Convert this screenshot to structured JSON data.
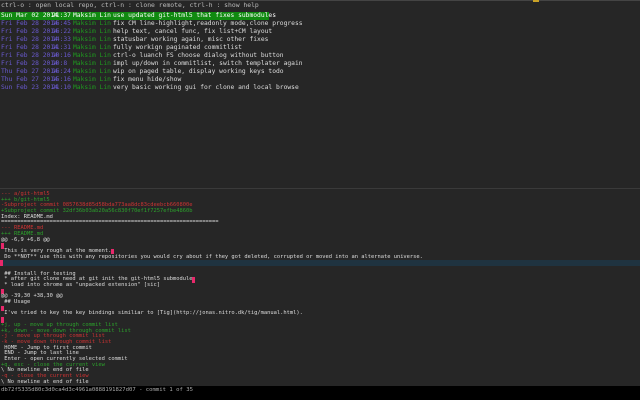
{
  "help_text": "ctrl-o : open local repo, ctrl-n : clone remote, ctrl-h : show help",
  "commits": [
    {
      "date": "Sun Mar 02 2014",
      "time": "21:37",
      "author": "Maksim Lin",
      "message": "use updated git-html5 that fixes submodules",
      "selected": true
    },
    {
      "date": "Fri Feb 28 2014",
      "time": "16:45",
      "author": "Maksim Lin",
      "message": "fix CM line-highlight,readonly mode,clone progress"
    },
    {
      "date": "Fri Feb 28 2014",
      "time": "16:22",
      "author": "Maksim Lin",
      "message": "help text, cancel func, fix list+CM layout"
    },
    {
      "date": "Fri Feb 28 2014",
      "time": "14:33",
      "author": "Maksim Lin",
      "message": "statusbar working again, misc other fixes"
    },
    {
      "date": "Fri Feb 28 2014",
      "time": "11:31",
      "author": "Maksim Lin",
      "message": "fully workign paginated commitlist"
    },
    {
      "date": "Fri Feb 28 2014",
      "time": "10:16",
      "author": "Maksim Lin",
      "message": "ctrl-o luanch FS choose dialog without button"
    },
    {
      "date": "Fri Feb 28 2014",
      "time": "10:8",
      "author": "Maksim Lin",
      "message": "impl up/down in commitlist, switch templater again"
    },
    {
      "date": "Thu Feb 27 2014",
      "time": "16:24",
      "author": "Maksim Lin",
      "message": "wip on paged table, display working keys todo"
    },
    {
      "date": "Thu Feb 27 2014",
      "time": "15:16",
      "author": "Maksim Lin",
      "message": "fix menu hide/show"
    },
    {
      "date": "Sun Feb 23 2014",
      "time": "21:10",
      "author": "Maksim Lin",
      "message": "very basic working gui for clone and local browse"
    }
  ],
  "diff_lines": [
    {
      "t": "--- a/git-html5",
      "k": "del"
    },
    {
      "t": "+++ b/git-html5",
      "k": "add"
    },
    {
      "t": "-Subproject commit 0857638d85d58bda773aa8dc83cdeebcb660800e",
      "k": "del"
    },
    {
      "t": "+Subproject commit 32df36b03ab20a56c830f70ef1f7257efbe4860b",
      "k": "add"
    },
    {
      "t": "Index: README.md",
      "k": ""
    },
    {
      "t": "===================================================================",
      "k": ""
    },
    {
      "t": "--- README.md",
      "k": "del"
    },
    {
      "t": "+++ README.md",
      "k": "add"
    },
    {
      "t": "@@ -6,9 +6,8 @@",
      "k": ""
    },
    {
      "t": "",
      "k": "",
      "m": true
    },
    {
      "t": " This is very rough at the moment.",
      "k": "",
      "me": true
    },
    {
      "t": " Do **NOT** use this with any repositories you would cry about if they got deleted, corrupted or moved into an alternate universe.",
      "k": ""
    },
    {
      "t": "",
      "k": "hl",
      "m": true
    },
    {
      "t": " ",
      "k": ""
    },
    {
      "t": " ## Install for testing",
      "k": ""
    },
    {
      "t": " * after git clone need at git init the git-html5 submodule",
      "k": "",
      "me": true
    },
    {
      "t": " * load into chrome as \"unpacked extension\" [sic]",
      "k": ""
    },
    {
      "t": "",
      "k": "",
      "m": true
    },
    {
      "t": "@@ -39,30 +38,30 @@",
      "k": ""
    },
    {
      "t": " ## Usage",
      "k": ""
    },
    {
      "t": "",
      "k": "",
      "m": true
    },
    {
      "t": " I've tried to key the key bindings similiar to [Tig](http://jonas.nitro.dk/tig/manual.html).",
      "k": ""
    },
    {
      "t": "",
      "k": "",
      "m": true
    },
    {
      "t": "+j, up - move up through commit list",
      "k": "add"
    },
    {
      "t": "+k, down - move down through commit list",
      "k": "add"
    },
    {
      "t": "-j - move up through commit list",
      "k": "del"
    },
    {
      "t": "-k - move down through commit list",
      "k": "del"
    },
    {
      "t": " HOME - Jump to first commit",
      "k": ""
    },
    {
      "t": " END - Jump to last line",
      "k": ""
    },
    {
      "t": " Enter - open currently selected commit",
      "k": ""
    },
    {
      "t": "+q, esc - close the current view",
      "k": "add"
    },
    {
      "t": "\\ No newline at end of file",
      "k": ""
    },
    {
      "t": "-q - close the current view",
      "k": "del"
    },
    {
      "t": "\\ No newline at end of file",
      "k": ""
    }
  ],
  "status_bar": "db72f5335d80c3d0ca4d3c4961a0888191827d07 - commit 1 of 35",
  "colors": {
    "selected": "#108a10",
    "date": "#6a5ad0",
    "author": "#1f9a1f",
    "added": "#2ca02c",
    "removed": "#c33",
    "marker": "#e8286b"
  }
}
